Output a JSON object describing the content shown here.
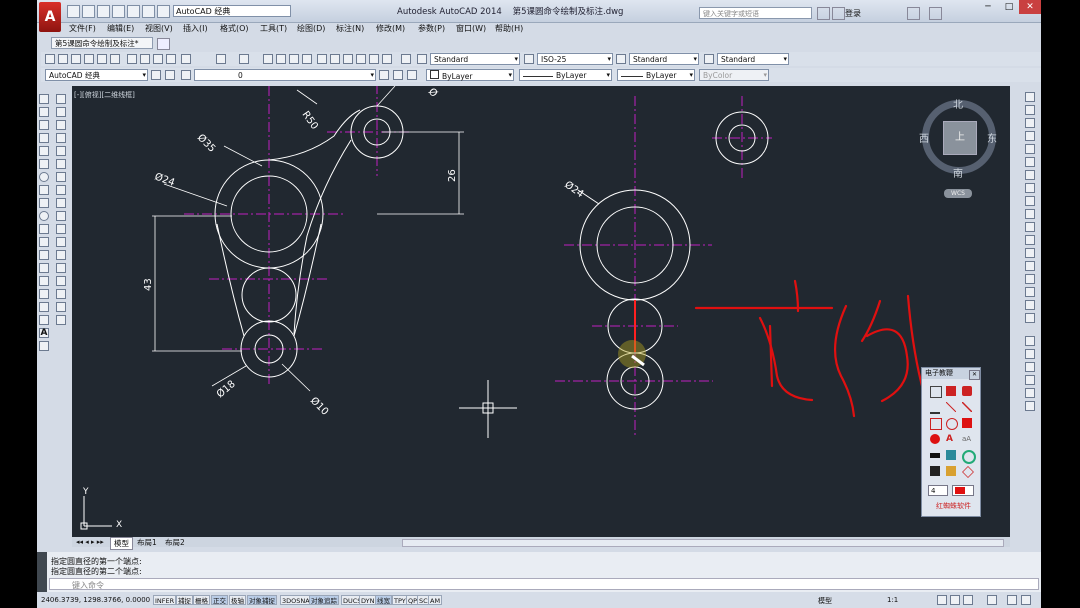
{
  "app": {
    "title": "Autodesk AutoCAD 2014",
    "document": "第5课圆命令绘制及标注.dwg",
    "workspace": "AutoCAD 经典",
    "search_placeholder": "键入关键字或短语",
    "login": "登录"
  },
  "menu": [
    "文件(F)",
    "编辑(E)",
    "视图(V)",
    "插入(I)",
    "格式(O)",
    "工具(T)",
    "绘图(D)",
    "标注(N)",
    "修改(M)",
    "参数(P)",
    "窗口(W)",
    "帮助(H)"
  ],
  "doc_tab": "第5课圆命令绘制及标注*",
  "styles_toolbar": {
    "text_style": "Standard",
    "dim_style": "ISO-25",
    "table_style": "Standard",
    "mleader_style": "Standard"
  },
  "layers_toolbar": {
    "workspace": "AutoCAD 经典",
    "layer": "0",
    "color": "ByLayer",
    "linetype": "ByLayer",
    "lineweight": "ByLayer",
    "plotstyle": "ByColor"
  },
  "viewport_label": "[-][俯视][二维线框]",
  "viewcube": {
    "north": "北",
    "south": "南",
    "east": "东",
    "west": "西",
    "top": "上",
    "wcs": "WCS"
  },
  "dimensions": {
    "r50": "R50",
    "d35": "Ø35",
    "d24": "Ø24",
    "d18": "Ø18",
    "d10": "Ø10",
    "dim26": "26",
    "dim43": "43",
    "d24b": "Ø24",
    "d_partial": "Ø"
  },
  "ucs": {
    "x": "X",
    "y": "Y"
  },
  "layout_tabs": [
    "模型",
    "布局1",
    "布局2"
  ],
  "command_lines": [
    "指定圆直径的第一个端点:",
    "指定圆直径的第二个端点:"
  ],
  "command_prompt": "键入命令",
  "coords": "2406.3739, 1298.3766, 0.0000",
  "status_buttons": [
    {
      "label": "INFER",
      "on": false
    },
    {
      "label": "捕捉",
      "on": false
    },
    {
      "label": "栅格",
      "on": false
    },
    {
      "label": "正交",
      "on": true
    },
    {
      "label": "极轴",
      "on": false
    },
    {
      "label": "对象捕捉",
      "on": true
    },
    {
      "label": "3DOSNAP",
      "on": false
    },
    {
      "label": "对象追踪",
      "on": true
    },
    {
      "label": "DUCS",
      "on": false
    },
    {
      "label": "DYN",
      "on": false
    },
    {
      "label": "线宽",
      "on": true
    },
    {
      "label": "TPY",
      "on": false
    },
    {
      "label": "QP",
      "on": false
    },
    {
      "label": "SC",
      "on": false
    },
    {
      "label": "AM",
      "on": false
    }
  ],
  "status_right": {
    "model": "模型",
    "scale": "1:1"
  },
  "palette": {
    "title": "电子教鞭",
    "width": "4",
    "footer": "红蜘蛛软件"
  },
  "colors": {
    "canvas": "#212830",
    "accent_red": "#e01010",
    "centerline": "#c020c0",
    "geometry": "#ffffff",
    "dimension": "#ffffff"
  }
}
